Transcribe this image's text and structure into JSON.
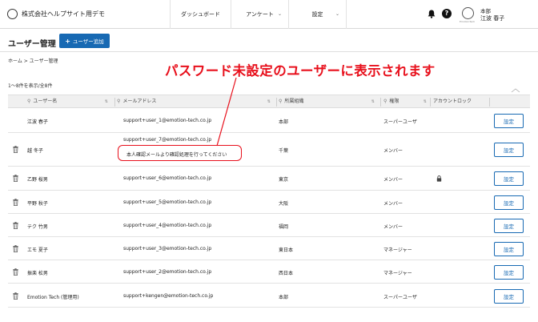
{
  "header": {
    "company": "株式会社ヘルプサイト用デモ",
    "nav": {
      "dashboard": "ダッシュボード",
      "anquete": "アンケート",
      "settings": "設定"
    },
    "user": {
      "dept": "本部",
      "name": "江波 春子",
      "avatar_caption": "EmotionTech"
    }
  },
  "page": {
    "title": "ユーザー管理",
    "add_button": "ユーザー追加",
    "breadcrumb": "ホーム > ユーザー管理",
    "annotation": "パスワード未設定のユーザーに表示されます",
    "count": "1〜8件を表示/全8件"
  },
  "table": {
    "headers": {
      "name": "ユーザー名",
      "email": "メールアドレス",
      "org": "所属組織",
      "role": "権限",
      "lock": "アカウントロック"
    },
    "set_label": "設定",
    "unverified_note": "本人確認メールより確認処理を行ってください",
    "rows": [
      {
        "name": "江波 春子",
        "email": "support+user_1@emotion-tech.co.jp",
        "org": "本部",
        "role": "スーパーユーザ"
      },
      {
        "name": "越 冬子",
        "email": "support+user_7@emotion-tech.co.jp",
        "org": "千葉",
        "role": "メンバー"
      },
      {
        "name": "乙野 桜男",
        "email": "support+user_6@emotion-tech.co.jp",
        "org": "東京",
        "role": "メンバー"
      },
      {
        "name": "平野 秋子",
        "email": "support+user_5@emotion-tech.co.jp",
        "org": "大阪",
        "role": "メンバー"
      },
      {
        "name": "テク 竹男",
        "email": "support+user_4@emotion-tech.co.jp",
        "org": "福岡",
        "role": "メンバー"
      },
      {
        "name": "エモ 夏子",
        "email": "support+user_3@emotion-tech.co.jp",
        "org": "東日本",
        "role": "マネージャー"
      },
      {
        "name": "振楽 松男",
        "email": "support+user_2@emotion-tech.co.jp",
        "org": "西日本",
        "role": "マネージャー"
      },
      {
        "name": "Emotion Tech (管理用)",
        "email": "support+kengen@emotion-tech.co.jp",
        "org": "本部",
        "role": "スーパーユーザ"
      }
    ]
  },
  "colors": {
    "primary": "#1769b3",
    "annotation": "#e8101c"
  }
}
